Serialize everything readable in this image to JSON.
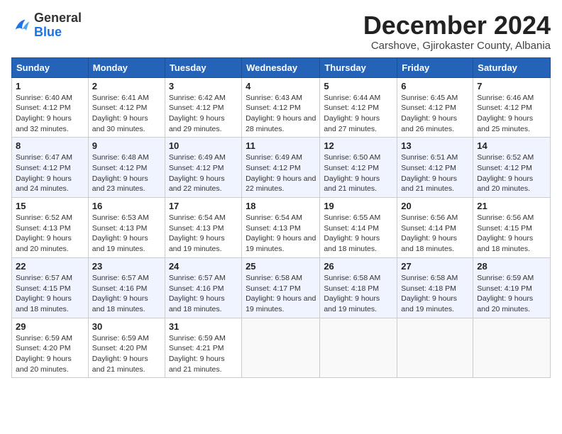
{
  "logo": {
    "general": "General",
    "blue": "Blue"
  },
  "title": "December 2024",
  "location": "Carshove, Gjirokaster County, Albania",
  "days_of_week": [
    "Sunday",
    "Monday",
    "Tuesday",
    "Wednesday",
    "Thursday",
    "Friday",
    "Saturday"
  ],
  "weeks": [
    [
      {
        "day": "1",
        "sunrise": "6:40 AM",
        "sunset": "4:12 PM",
        "daylight": "9 hours and 32 minutes."
      },
      {
        "day": "2",
        "sunrise": "6:41 AM",
        "sunset": "4:12 PM",
        "daylight": "9 hours and 30 minutes."
      },
      {
        "day": "3",
        "sunrise": "6:42 AM",
        "sunset": "4:12 PM",
        "daylight": "9 hours and 29 minutes."
      },
      {
        "day": "4",
        "sunrise": "6:43 AM",
        "sunset": "4:12 PM",
        "daylight": "9 hours and 28 minutes."
      },
      {
        "day": "5",
        "sunrise": "6:44 AM",
        "sunset": "4:12 PM",
        "daylight": "9 hours and 27 minutes."
      },
      {
        "day": "6",
        "sunrise": "6:45 AM",
        "sunset": "4:12 PM",
        "daylight": "9 hours and 26 minutes."
      },
      {
        "day": "7",
        "sunrise": "6:46 AM",
        "sunset": "4:12 PM",
        "daylight": "9 hours and 25 minutes."
      }
    ],
    [
      {
        "day": "8",
        "sunrise": "6:47 AM",
        "sunset": "4:12 PM",
        "daylight": "9 hours and 24 minutes."
      },
      {
        "day": "9",
        "sunrise": "6:48 AM",
        "sunset": "4:12 PM",
        "daylight": "9 hours and 23 minutes."
      },
      {
        "day": "10",
        "sunrise": "6:49 AM",
        "sunset": "4:12 PM",
        "daylight": "9 hours and 22 minutes."
      },
      {
        "day": "11",
        "sunrise": "6:49 AM",
        "sunset": "4:12 PM",
        "daylight": "9 hours and 22 minutes."
      },
      {
        "day": "12",
        "sunrise": "6:50 AM",
        "sunset": "4:12 PM",
        "daylight": "9 hours and 21 minutes."
      },
      {
        "day": "13",
        "sunrise": "6:51 AM",
        "sunset": "4:12 PM",
        "daylight": "9 hours and 21 minutes."
      },
      {
        "day": "14",
        "sunrise": "6:52 AM",
        "sunset": "4:12 PM",
        "daylight": "9 hours and 20 minutes."
      }
    ],
    [
      {
        "day": "15",
        "sunrise": "6:52 AM",
        "sunset": "4:13 PM",
        "daylight": "9 hours and 20 minutes."
      },
      {
        "day": "16",
        "sunrise": "6:53 AM",
        "sunset": "4:13 PM",
        "daylight": "9 hours and 19 minutes."
      },
      {
        "day": "17",
        "sunrise": "6:54 AM",
        "sunset": "4:13 PM",
        "daylight": "9 hours and 19 minutes."
      },
      {
        "day": "18",
        "sunrise": "6:54 AM",
        "sunset": "4:13 PM",
        "daylight": "9 hours and 19 minutes."
      },
      {
        "day": "19",
        "sunrise": "6:55 AM",
        "sunset": "4:14 PM",
        "daylight": "9 hours and 18 minutes."
      },
      {
        "day": "20",
        "sunrise": "6:56 AM",
        "sunset": "4:14 PM",
        "daylight": "9 hours and 18 minutes."
      },
      {
        "day": "21",
        "sunrise": "6:56 AM",
        "sunset": "4:15 PM",
        "daylight": "9 hours and 18 minutes."
      }
    ],
    [
      {
        "day": "22",
        "sunrise": "6:57 AM",
        "sunset": "4:15 PM",
        "daylight": "9 hours and 18 minutes."
      },
      {
        "day": "23",
        "sunrise": "6:57 AM",
        "sunset": "4:16 PM",
        "daylight": "9 hours and 18 minutes."
      },
      {
        "day": "24",
        "sunrise": "6:57 AM",
        "sunset": "4:16 PM",
        "daylight": "9 hours and 18 minutes."
      },
      {
        "day": "25",
        "sunrise": "6:58 AM",
        "sunset": "4:17 PM",
        "daylight": "9 hours and 19 minutes."
      },
      {
        "day": "26",
        "sunrise": "6:58 AM",
        "sunset": "4:18 PM",
        "daylight": "9 hours and 19 minutes."
      },
      {
        "day": "27",
        "sunrise": "6:58 AM",
        "sunset": "4:18 PM",
        "daylight": "9 hours and 19 minutes."
      },
      {
        "day": "28",
        "sunrise": "6:59 AM",
        "sunset": "4:19 PM",
        "daylight": "9 hours and 20 minutes."
      }
    ],
    [
      {
        "day": "29",
        "sunrise": "6:59 AM",
        "sunset": "4:20 PM",
        "daylight": "9 hours and 20 minutes."
      },
      {
        "day": "30",
        "sunrise": "6:59 AM",
        "sunset": "4:20 PM",
        "daylight": "9 hours and 21 minutes."
      },
      {
        "day": "31",
        "sunrise": "6:59 AM",
        "sunset": "4:21 PM",
        "daylight": "9 hours and 21 minutes."
      },
      null,
      null,
      null,
      null
    ]
  ]
}
